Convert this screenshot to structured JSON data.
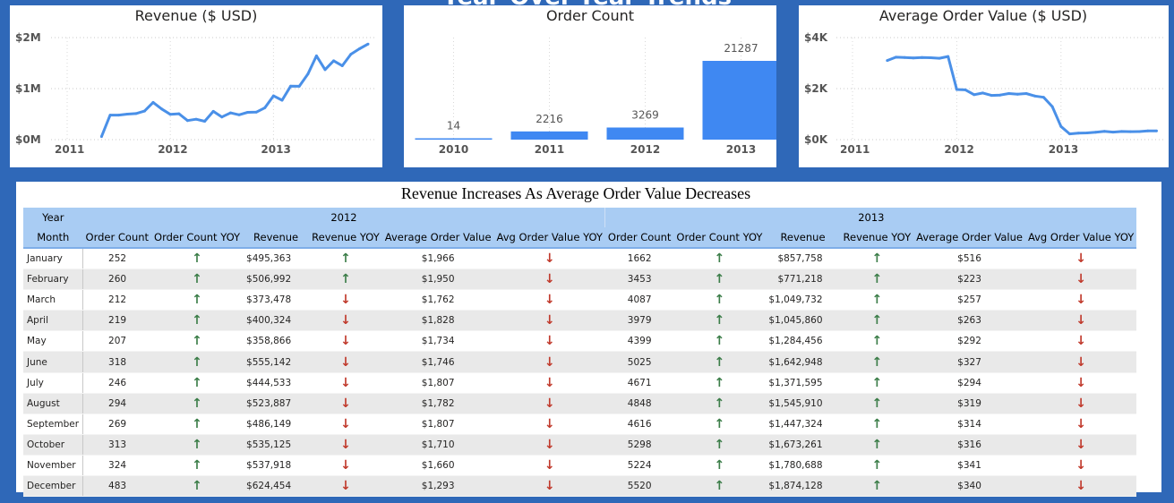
{
  "page_title": "Year-Over-Year Trends",
  "colors": {
    "background": "#2f68b8",
    "series": "#4a90e8",
    "bar": "#3f88f2",
    "header": "#a9ccf3",
    "up": "#3b7d48",
    "down": "#c0392b"
  },
  "icons": {
    "up": "arrow-up-icon",
    "down": "arrow-down-icon"
  },
  "chart_data": [
    {
      "type": "line",
      "title": "Revenue ($ USD)",
      "x_ticks": [
        "2011",
        "2012",
        "2013"
      ],
      "y_ticks": [
        "$0M",
        "$1M",
        "$2M"
      ],
      "ylim": [
        0,
        2000000
      ],
      "x": [
        "2011-05",
        "2011-06",
        "2011-07",
        "2011-08",
        "2011-09",
        "2011-10",
        "2011-11",
        "2011-12",
        "2012-01",
        "2012-02",
        "2012-03",
        "2012-04",
        "2012-05",
        "2012-06",
        "2012-07",
        "2012-08",
        "2012-09",
        "2012-10",
        "2012-11",
        "2012-12",
        "2013-01",
        "2013-02",
        "2013-03",
        "2013-04",
        "2013-05",
        "2013-06",
        "2013-07",
        "2013-08",
        "2013-09",
        "2013-10",
        "2013-11",
        "2013-12"
      ],
      "values": [
        60000,
        480000,
        480000,
        500000,
        510000,
        560000,
        730000,
        600000,
        495363,
        506992,
        373478,
        400324,
        358866,
        555142,
        444533,
        523887,
        486149,
        535125,
        537918,
        624454,
        857758,
        771218,
        1049732,
        1045860,
        1284456,
        1642948,
        1371595,
        1545910,
        1447324,
        1673261,
        1780688,
        1874128
      ],
      "grid": true
    },
    {
      "type": "bar",
      "title": "Order Count",
      "categories": [
        "2010",
        "2011",
        "2012",
        "2013"
      ],
      "values": [
        14,
        2216,
        3269,
        21287
      ],
      "grid": false
    },
    {
      "type": "line",
      "title": "Average Order Value ($ USD)",
      "x_ticks": [
        "2011",
        "2012",
        "2013"
      ],
      "y_ticks": [
        "$0K",
        "$2K",
        "$4K"
      ],
      "ylim": [
        0,
        4000
      ],
      "x": [
        "2011-05",
        "2011-06",
        "2011-07",
        "2011-08",
        "2011-09",
        "2011-10",
        "2011-11",
        "2011-12",
        "2012-01",
        "2012-02",
        "2012-03",
        "2012-04",
        "2012-05",
        "2012-06",
        "2012-07",
        "2012-08",
        "2012-09",
        "2012-10",
        "2012-11",
        "2012-12",
        "2013-01",
        "2013-02",
        "2013-03",
        "2013-04",
        "2013-05",
        "2013-06",
        "2013-07",
        "2013-08",
        "2013-09",
        "2013-10",
        "2013-11",
        "2013-12"
      ],
      "values": [
        3100,
        3230,
        3220,
        3200,
        3220,
        3210,
        3190,
        3260,
        1966,
        1950,
        1762,
        1828,
        1734,
        1746,
        1807,
        1782,
        1807,
        1710,
        1660,
        1293,
        516,
        223,
        257,
        263,
        292,
        327,
        294,
        319,
        314,
        316,
        341,
        340
      ],
      "grid": true
    }
  ],
  "table": {
    "title": "Revenue Increases As Average Order Value Decreases",
    "year_label": "Year",
    "month_label": "Month",
    "years": [
      "2012",
      "2013"
    ],
    "columns": [
      "Order Count",
      "Order Count YOY",
      "Revenue",
      "Revenue YOY",
      "Average Order Value",
      "Avg Order Value YOY"
    ],
    "rows": [
      {
        "month": "January",
        "y2012": {
          "count": "252",
          "count_yoy": "up",
          "revenue": "$495,363",
          "revenue_yoy": "up",
          "aov": "$1,966",
          "aov_yoy": "down"
        },
        "y2013": {
          "count": "1662",
          "count_yoy": "up",
          "revenue": "$857,758",
          "revenue_yoy": "up",
          "aov": "$516",
          "aov_yoy": "down"
        }
      },
      {
        "month": "February",
        "y2012": {
          "count": "260",
          "count_yoy": "up",
          "revenue": "$506,992",
          "revenue_yoy": "up",
          "aov": "$1,950",
          "aov_yoy": "down"
        },
        "y2013": {
          "count": "3453",
          "count_yoy": "up",
          "revenue": "$771,218",
          "revenue_yoy": "up",
          "aov": "$223",
          "aov_yoy": "down"
        }
      },
      {
        "month": "March",
        "y2012": {
          "count": "212",
          "count_yoy": "up",
          "revenue": "$373,478",
          "revenue_yoy": "down",
          "aov": "$1,762",
          "aov_yoy": "down"
        },
        "y2013": {
          "count": "4087",
          "count_yoy": "up",
          "revenue": "$1,049,732",
          "revenue_yoy": "up",
          "aov": "$257",
          "aov_yoy": "down"
        }
      },
      {
        "month": "April",
        "y2012": {
          "count": "219",
          "count_yoy": "up",
          "revenue": "$400,324",
          "revenue_yoy": "down",
          "aov": "$1,828",
          "aov_yoy": "down"
        },
        "y2013": {
          "count": "3979",
          "count_yoy": "up",
          "revenue": "$1,045,860",
          "revenue_yoy": "up",
          "aov": "$263",
          "aov_yoy": "down"
        }
      },
      {
        "month": "May",
        "y2012": {
          "count": "207",
          "count_yoy": "up",
          "revenue": "$358,866",
          "revenue_yoy": "down",
          "aov": "$1,734",
          "aov_yoy": "down"
        },
        "y2013": {
          "count": "4399",
          "count_yoy": "up",
          "revenue": "$1,284,456",
          "revenue_yoy": "up",
          "aov": "$292",
          "aov_yoy": "down"
        }
      },
      {
        "month": "June",
        "y2012": {
          "count": "318",
          "count_yoy": "up",
          "revenue": "$555,142",
          "revenue_yoy": "down",
          "aov": "$1,746",
          "aov_yoy": "down"
        },
        "y2013": {
          "count": "5025",
          "count_yoy": "up",
          "revenue": "$1,642,948",
          "revenue_yoy": "up",
          "aov": "$327",
          "aov_yoy": "down"
        }
      },
      {
        "month": "July",
        "y2012": {
          "count": "246",
          "count_yoy": "up",
          "revenue": "$444,533",
          "revenue_yoy": "down",
          "aov": "$1,807",
          "aov_yoy": "down"
        },
        "y2013": {
          "count": "4671",
          "count_yoy": "up",
          "revenue": "$1,371,595",
          "revenue_yoy": "up",
          "aov": "$294",
          "aov_yoy": "down"
        }
      },
      {
        "month": "August",
        "y2012": {
          "count": "294",
          "count_yoy": "up",
          "revenue": "$523,887",
          "revenue_yoy": "down",
          "aov": "$1,782",
          "aov_yoy": "down"
        },
        "y2013": {
          "count": "4848",
          "count_yoy": "up",
          "revenue": "$1,545,910",
          "revenue_yoy": "up",
          "aov": "$319",
          "aov_yoy": "down"
        }
      },
      {
        "month": "September",
        "y2012": {
          "count": "269",
          "count_yoy": "up",
          "revenue": "$486,149",
          "revenue_yoy": "down",
          "aov": "$1,807",
          "aov_yoy": "down"
        },
        "y2013": {
          "count": "4616",
          "count_yoy": "up",
          "revenue": "$1,447,324",
          "revenue_yoy": "up",
          "aov": "$314",
          "aov_yoy": "down"
        }
      },
      {
        "month": "October",
        "y2012": {
          "count": "313",
          "count_yoy": "up",
          "revenue": "$535,125",
          "revenue_yoy": "down",
          "aov": "$1,710",
          "aov_yoy": "down"
        },
        "y2013": {
          "count": "5298",
          "count_yoy": "up",
          "revenue": "$1,673,261",
          "revenue_yoy": "up",
          "aov": "$316",
          "aov_yoy": "down"
        }
      },
      {
        "month": "November",
        "y2012": {
          "count": "324",
          "count_yoy": "up",
          "revenue": "$537,918",
          "revenue_yoy": "down",
          "aov": "$1,660",
          "aov_yoy": "down"
        },
        "y2013": {
          "count": "5224",
          "count_yoy": "up",
          "revenue": "$1,780,688",
          "revenue_yoy": "up",
          "aov": "$341",
          "aov_yoy": "down"
        }
      },
      {
        "month": "December",
        "y2012": {
          "count": "483",
          "count_yoy": "up",
          "revenue": "$624,454",
          "revenue_yoy": "down",
          "aov": "$1,293",
          "aov_yoy": "down"
        },
        "y2013": {
          "count": "5520",
          "count_yoy": "up",
          "revenue": "$1,874,128",
          "revenue_yoy": "up",
          "aov": "$340",
          "aov_yoy": "down"
        }
      }
    ]
  }
}
